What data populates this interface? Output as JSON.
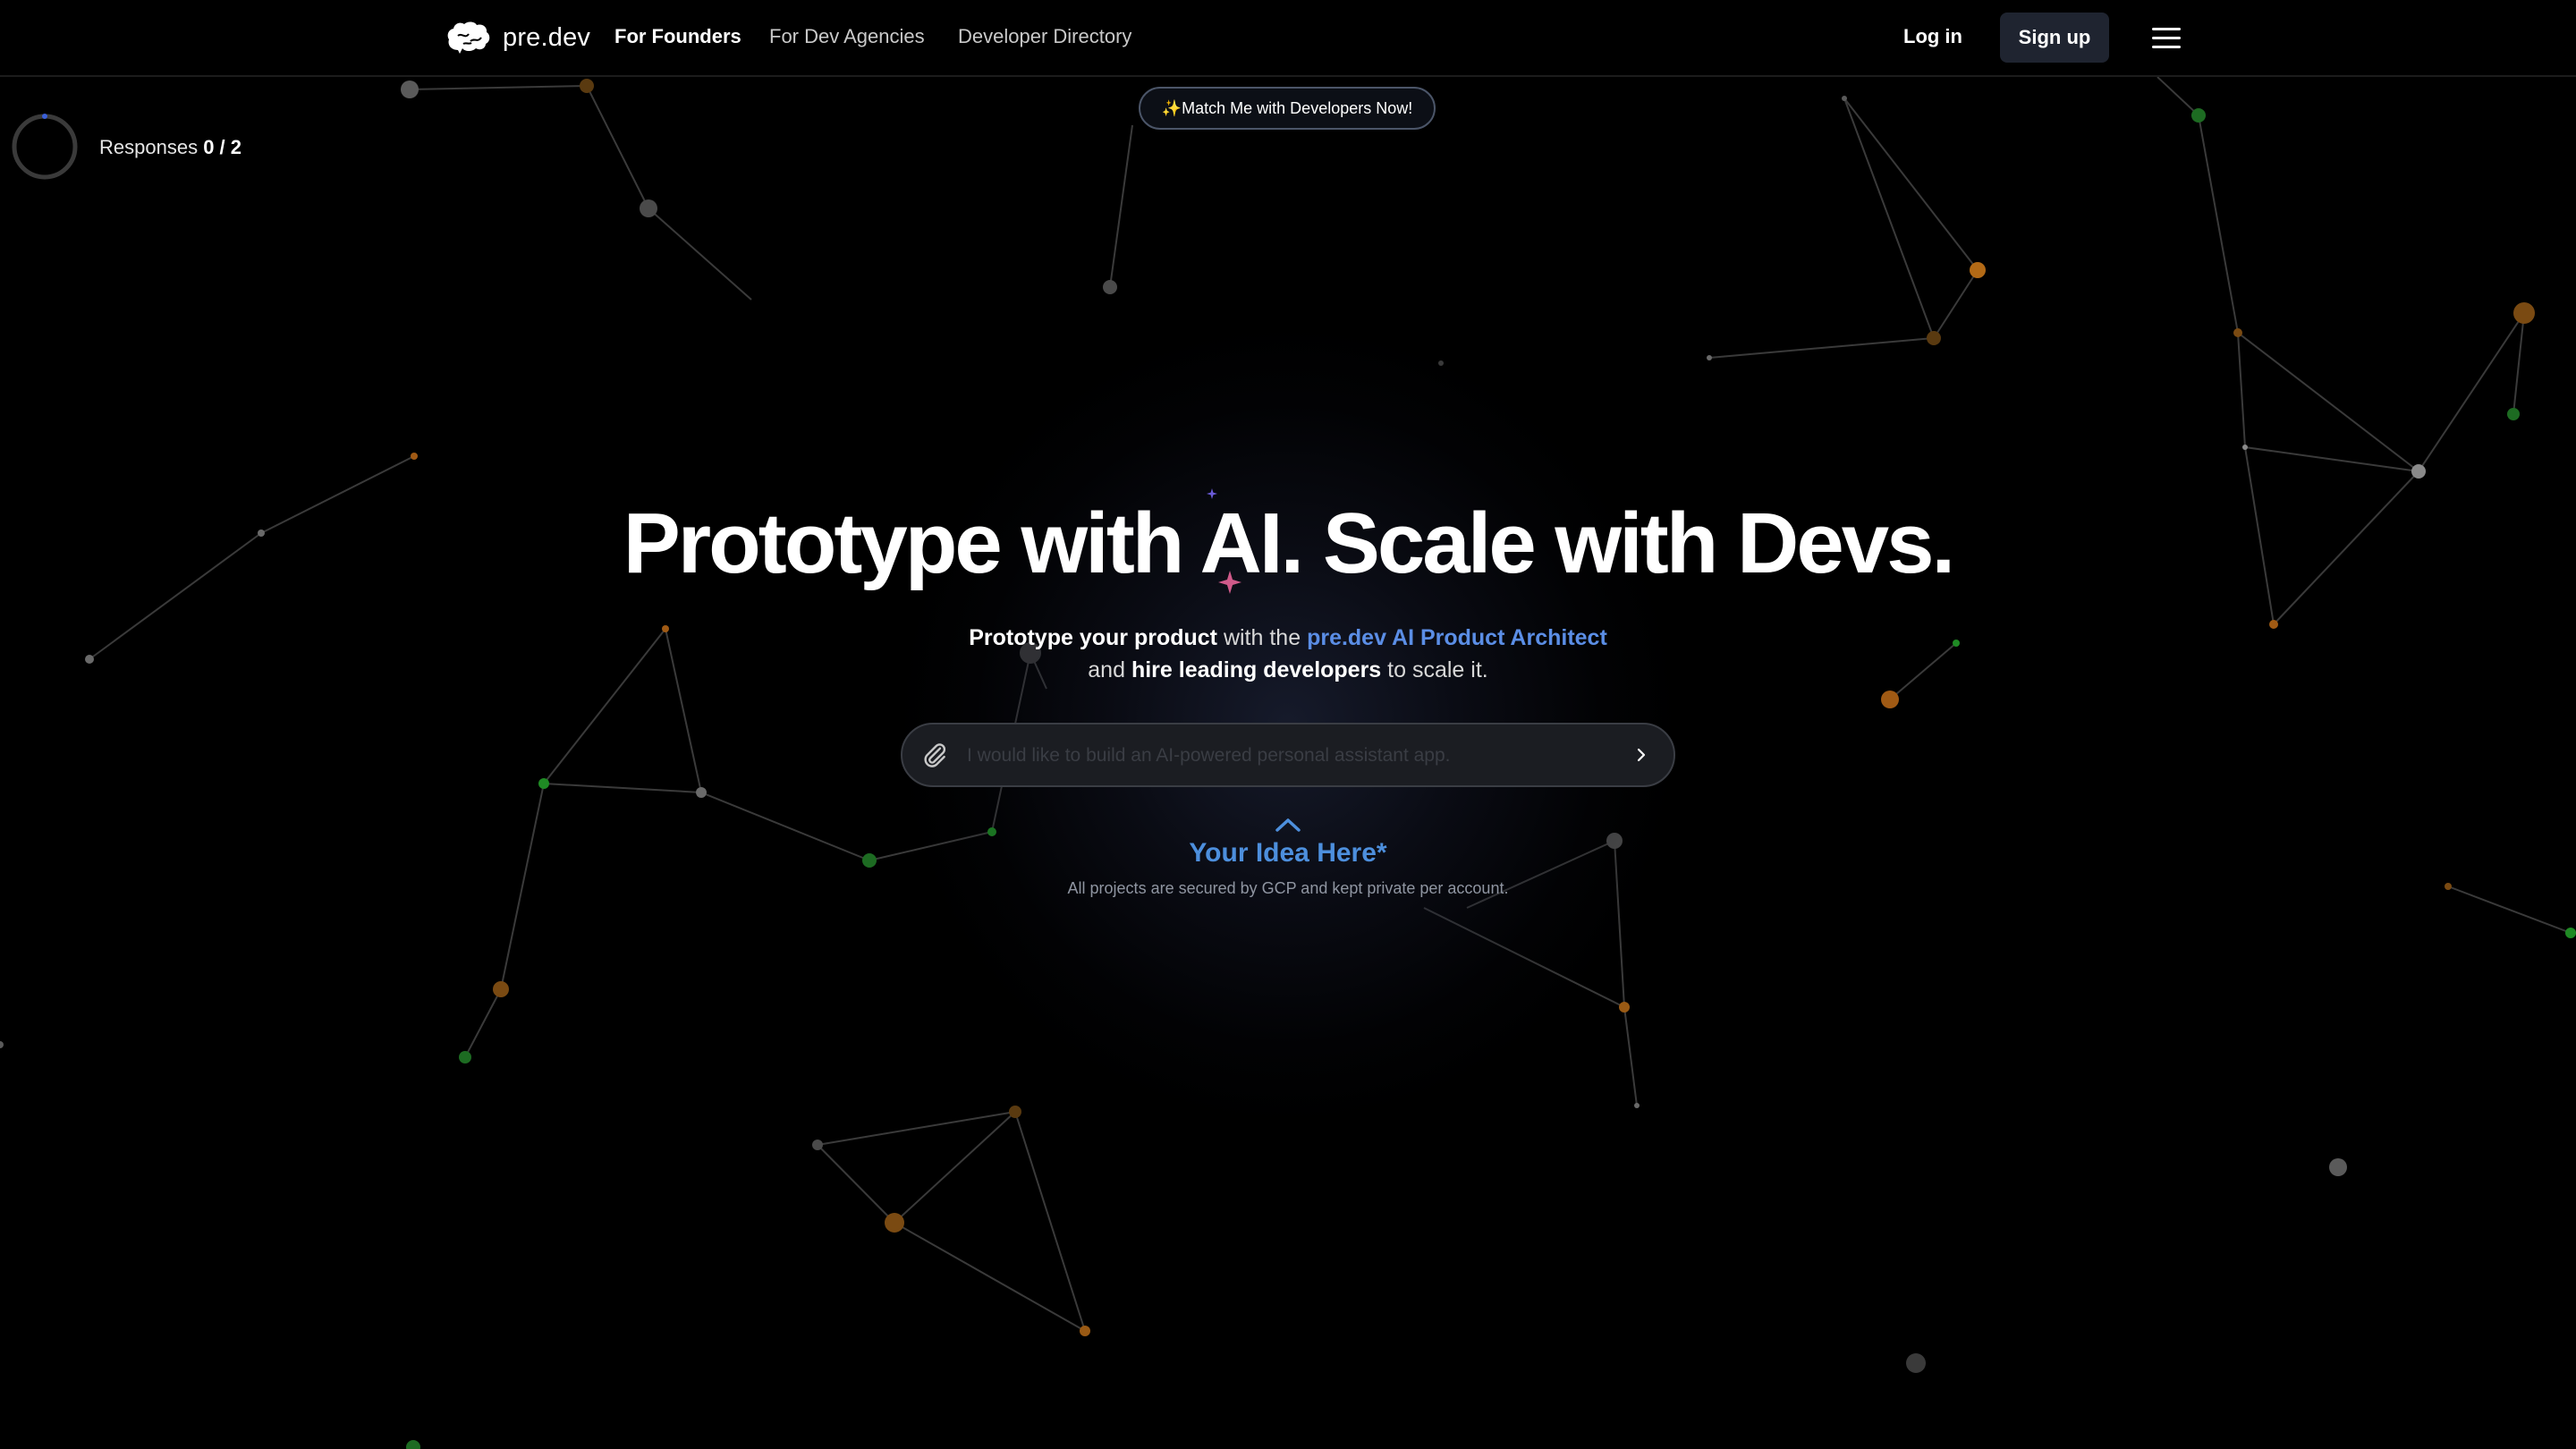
{
  "nav": {
    "brand": "pre.dev",
    "links": [
      "For Founders",
      "For Dev Agencies",
      "Developer Directory"
    ],
    "active_link": "For Founders",
    "login": "Log in",
    "signup": "Sign up"
  },
  "match_button": "✨Match Me with Developers Now!",
  "responses": {
    "label": "Responses",
    "count": "0 / 2"
  },
  "hero": {
    "title": "Prototype with AI. Scale with Devs.",
    "line1": {
      "bold1": "Prototype your product",
      "mid": " with the ",
      "accent": "pre.dev AI Product Architect"
    },
    "line2": {
      "pre": "and ",
      "bold": "hire leading developers",
      "post": " to scale it."
    }
  },
  "prompt": {
    "placeholder": "I would like to build an AI-powered personal assistant app.",
    "value": ""
  },
  "idea_label": "Your Idea Here*",
  "security_note": "All projects are secured by GCP and kept private per account.",
  "icons": {
    "logo": "brain-icon",
    "menu": "hamburger-menu-icon",
    "attach": "paperclip-icon",
    "send": "chevron-right-icon",
    "idea": "chevron-up-icon",
    "progress": "progress-ring-icon"
  },
  "colors": {
    "accent": "#5b8ee6",
    "idea": "#4d8fdd",
    "node_orange": "#b36a16",
    "node_green": "#1f8a24",
    "node_gray": "#8a8a8a",
    "signup_bg": "#1f2430"
  }
}
